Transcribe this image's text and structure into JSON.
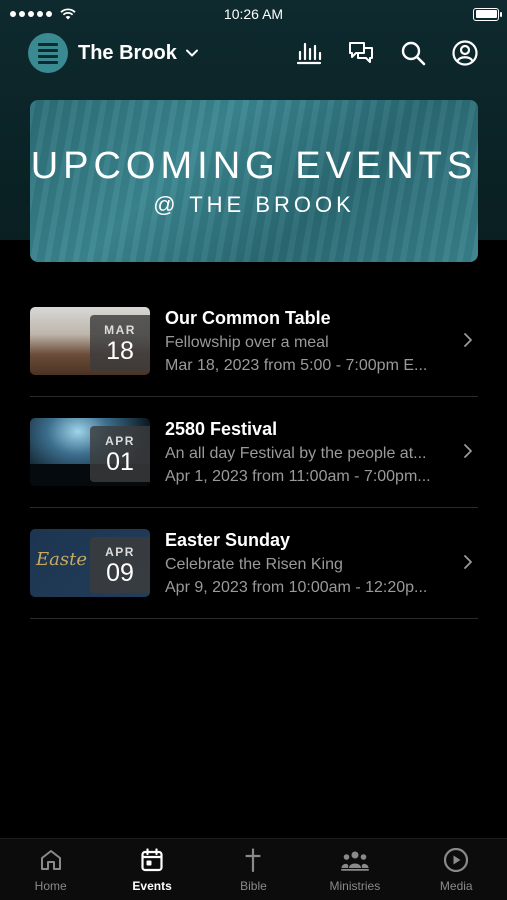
{
  "status": {
    "time": "10:26 AM"
  },
  "header": {
    "brand": "The Brook"
  },
  "banner": {
    "title": "UPCOMING EVENTS",
    "subtitle": "@ THE BROOK"
  },
  "events": [
    {
      "title": "Our Common Table",
      "desc": "Fellowship over a meal",
      "when": "Mar 18, 2023 from 5:00 - 7:00pm E...",
      "month": "MAR",
      "day": "18"
    },
    {
      "title": "2580 Festival",
      "desc": "An all day Festival by the people at...",
      "when": "Apr 1, 2023 from 11:00am - 7:00pm...",
      "month": "APR",
      "day": "01"
    },
    {
      "title": "Easter Sunday",
      "desc": "Celebrate the Risen King",
      "when": "Apr 9, 2023 from 10:00am - 12:20p...",
      "month": "APR",
      "day": "09",
      "thumb_text": "Easte"
    }
  ],
  "tabs": [
    {
      "label": "Home",
      "icon": "home-icon"
    },
    {
      "label": "Events",
      "icon": "calendar-icon",
      "active": true
    },
    {
      "label": "Bible",
      "icon": "cross-icon"
    },
    {
      "label": "Ministries",
      "icon": "people-icon"
    },
    {
      "label": "Media",
      "icon": "play-icon"
    }
  ],
  "colors": {
    "accent": "#3a8a91",
    "background": "#000000",
    "header_bg": "#0e2a2e"
  }
}
